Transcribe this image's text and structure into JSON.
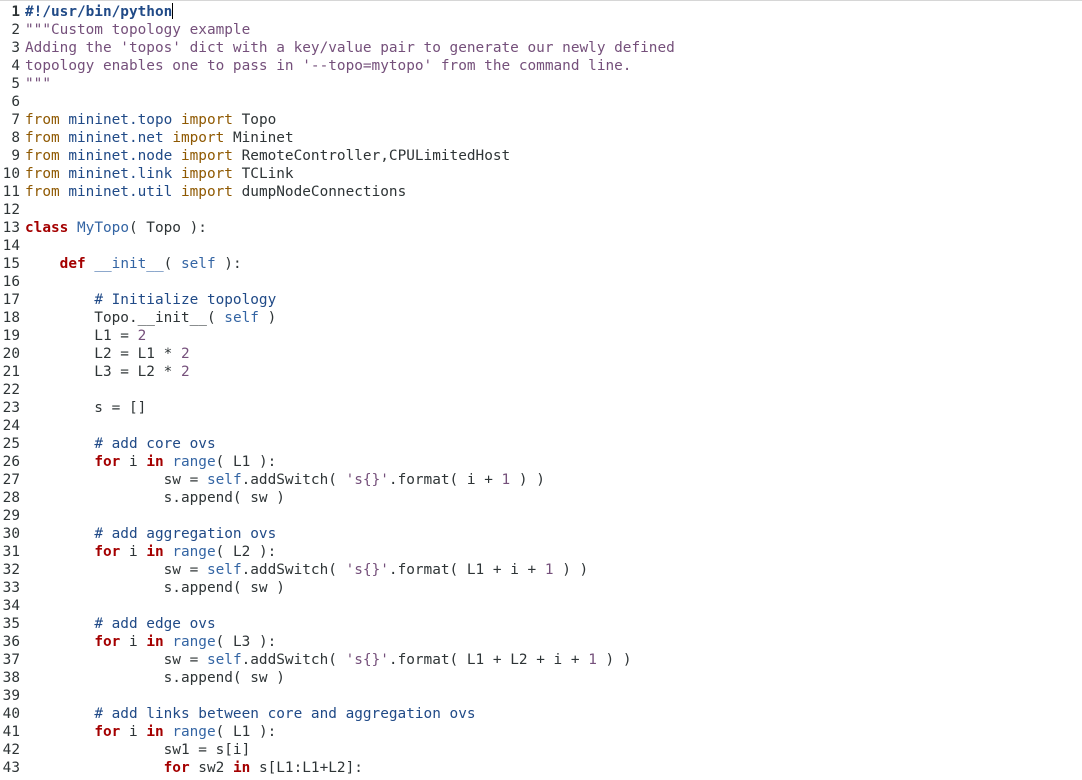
{
  "editor": {
    "current_line": 1,
    "lines": [
      {
        "n": "1",
        "tokens": [
          [
            "shebang",
            "#!/usr/bin/python"
          ]
        ]
      },
      {
        "n": "2",
        "tokens": [
          [
            "docstr",
            "\"\"\"Custom topology example"
          ]
        ]
      },
      {
        "n": "3",
        "tokens": [
          [
            "docstr",
            "Adding the 'topos' dict with a key/value pair to generate our newly defined"
          ]
        ]
      },
      {
        "n": "4",
        "tokens": [
          [
            "docstr",
            "topology enables one to pass in '--topo=mytopo' from the command line."
          ]
        ]
      },
      {
        "n": "5",
        "tokens": [
          [
            "docstr",
            "\"\"\""
          ]
        ]
      },
      {
        "n": "6",
        "tokens": []
      },
      {
        "n": "7",
        "tokens": [
          [
            "imp",
            "from"
          ],
          [
            "plain",
            " "
          ],
          [
            "mod",
            "mininet.topo"
          ],
          [
            "plain",
            " "
          ],
          [
            "imp",
            "import"
          ],
          [
            "plain",
            " Topo"
          ]
        ]
      },
      {
        "n": "8",
        "tokens": [
          [
            "imp",
            "from"
          ],
          [
            "plain",
            " "
          ],
          [
            "mod",
            "mininet.net"
          ],
          [
            "plain",
            " "
          ],
          [
            "imp",
            "import"
          ],
          [
            "plain",
            " Mininet"
          ]
        ]
      },
      {
        "n": "9",
        "tokens": [
          [
            "imp",
            "from"
          ],
          [
            "plain",
            " "
          ],
          [
            "mod",
            "mininet.node"
          ],
          [
            "plain",
            " "
          ],
          [
            "imp",
            "import"
          ],
          [
            "plain",
            " RemoteController,CPULimitedHost"
          ]
        ]
      },
      {
        "n": "10",
        "tokens": [
          [
            "imp",
            "from"
          ],
          [
            "plain",
            " "
          ],
          [
            "mod",
            "mininet.link"
          ],
          [
            "plain",
            " "
          ],
          [
            "imp",
            "import"
          ],
          [
            "plain",
            " TCLink"
          ]
        ]
      },
      {
        "n": "11",
        "tokens": [
          [
            "imp",
            "from"
          ],
          [
            "plain",
            " "
          ],
          [
            "mod",
            "mininet.util"
          ],
          [
            "plain",
            " "
          ],
          [
            "imp",
            "import"
          ],
          [
            "plain",
            " dumpNodeConnections"
          ]
        ]
      },
      {
        "n": "12",
        "tokens": []
      },
      {
        "n": "13",
        "tokens": [
          [
            "kw",
            "class"
          ],
          [
            "plain",
            " "
          ],
          [
            "cls",
            "MyTopo"
          ],
          [
            "plain",
            "( Topo ):"
          ]
        ]
      },
      {
        "n": "14",
        "tokens": []
      },
      {
        "n": "15",
        "tokens": [
          [
            "plain",
            "    "
          ],
          [
            "kw",
            "def"
          ],
          [
            "plain",
            " "
          ],
          [
            "cls",
            "__init__"
          ],
          [
            "plain",
            "( "
          ],
          [
            "self",
            "self"
          ],
          [
            "plain",
            " ):"
          ]
        ]
      },
      {
        "n": "16",
        "tokens": []
      },
      {
        "n": "17",
        "tokens": [
          [
            "plain",
            "        "
          ],
          [
            "cmt",
            "# Initialize topology"
          ]
        ]
      },
      {
        "n": "18",
        "tokens": [
          [
            "plain",
            "        Topo.__init__( "
          ],
          [
            "self",
            "self"
          ],
          [
            "plain",
            " )"
          ]
        ]
      },
      {
        "n": "19",
        "tokens": [
          [
            "plain",
            "        L1 = "
          ],
          [
            "num",
            "2"
          ]
        ]
      },
      {
        "n": "20",
        "tokens": [
          [
            "plain",
            "        L2 = L1 * "
          ],
          [
            "num",
            "2"
          ]
        ]
      },
      {
        "n": "21",
        "tokens": [
          [
            "plain",
            "        L3 = L2 * "
          ],
          [
            "num",
            "2"
          ]
        ]
      },
      {
        "n": "22",
        "tokens": []
      },
      {
        "n": "23",
        "tokens": [
          [
            "plain",
            "        s = []"
          ]
        ]
      },
      {
        "n": "24",
        "tokens": []
      },
      {
        "n": "25",
        "tokens": [
          [
            "plain",
            "        "
          ],
          [
            "cmt",
            "# add core ovs"
          ]
        ]
      },
      {
        "n": "26",
        "tokens": [
          [
            "plain",
            "        "
          ],
          [
            "kw",
            "for"
          ],
          [
            "plain",
            " i "
          ],
          [
            "kw",
            "in"
          ],
          [
            "plain",
            " "
          ],
          [
            "builtin",
            "range"
          ],
          [
            "plain",
            "( L1 ):"
          ]
        ]
      },
      {
        "n": "27",
        "tokens": [
          [
            "plain",
            "                sw = "
          ],
          [
            "self",
            "self"
          ],
          [
            "plain",
            ".addSwitch( "
          ],
          [
            "str",
            "'s{}'"
          ],
          [
            "plain",
            ".format( i + "
          ],
          [
            "num",
            "1"
          ],
          [
            "plain",
            " ) )"
          ]
        ]
      },
      {
        "n": "28",
        "tokens": [
          [
            "plain",
            "                s.append( sw )"
          ]
        ]
      },
      {
        "n": "29",
        "tokens": []
      },
      {
        "n": "30",
        "tokens": [
          [
            "plain",
            "        "
          ],
          [
            "cmt",
            "# add aggregation ovs"
          ]
        ]
      },
      {
        "n": "31",
        "tokens": [
          [
            "plain",
            "        "
          ],
          [
            "kw",
            "for"
          ],
          [
            "plain",
            " i "
          ],
          [
            "kw",
            "in"
          ],
          [
            "plain",
            " "
          ],
          [
            "builtin",
            "range"
          ],
          [
            "plain",
            "( L2 ):"
          ]
        ]
      },
      {
        "n": "32",
        "tokens": [
          [
            "plain",
            "                sw = "
          ],
          [
            "self",
            "self"
          ],
          [
            "plain",
            ".addSwitch( "
          ],
          [
            "str",
            "'s{}'"
          ],
          [
            "plain",
            ".format( L1 + i + "
          ],
          [
            "num",
            "1"
          ],
          [
            "plain",
            " ) )"
          ]
        ]
      },
      {
        "n": "33",
        "tokens": [
          [
            "plain",
            "                s.append( sw )"
          ]
        ]
      },
      {
        "n": "34",
        "tokens": []
      },
      {
        "n": "35",
        "tokens": [
          [
            "plain",
            "        "
          ],
          [
            "cmt",
            "# add edge ovs"
          ]
        ]
      },
      {
        "n": "36",
        "tokens": [
          [
            "plain",
            "        "
          ],
          [
            "kw",
            "for"
          ],
          [
            "plain",
            " i "
          ],
          [
            "kw",
            "in"
          ],
          [
            "plain",
            " "
          ],
          [
            "builtin",
            "range"
          ],
          [
            "plain",
            "( L3 ):"
          ]
        ]
      },
      {
        "n": "37",
        "tokens": [
          [
            "plain",
            "                sw = "
          ],
          [
            "self",
            "self"
          ],
          [
            "plain",
            ".addSwitch( "
          ],
          [
            "str",
            "'s{}'"
          ],
          [
            "plain",
            ".format( L1 + L2 + i + "
          ],
          [
            "num",
            "1"
          ],
          [
            "plain",
            " ) )"
          ]
        ]
      },
      {
        "n": "38",
        "tokens": [
          [
            "plain",
            "                s.append( sw )"
          ]
        ]
      },
      {
        "n": "39",
        "tokens": []
      },
      {
        "n": "40",
        "tokens": [
          [
            "plain",
            "        "
          ],
          [
            "cmt",
            "# add links between core and aggregation ovs"
          ]
        ]
      },
      {
        "n": "41",
        "tokens": [
          [
            "plain",
            "        "
          ],
          [
            "kw",
            "for"
          ],
          [
            "plain",
            " i "
          ],
          [
            "kw",
            "in"
          ],
          [
            "plain",
            " "
          ],
          [
            "builtin",
            "range"
          ],
          [
            "plain",
            "( L1 ):"
          ]
        ]
      },
      {
        "n": "42",
        "tokens": [
          [
            "plain",
            "                sw1 = s[i]"
          ]
        ]
      },
      {
        "n": "43",
        "tokens": [
          [
            "plain",
            "                "
          ],
          [
            "kw",
            "for"
          ],
          [
            "plain",
            " sw2 "
          ],
          [
            "kw",
            "in"
          ],
          [
            "plain",
            " s[L1:L1+L2]:"
          ]
        ]
      }
    ]
  }
}
